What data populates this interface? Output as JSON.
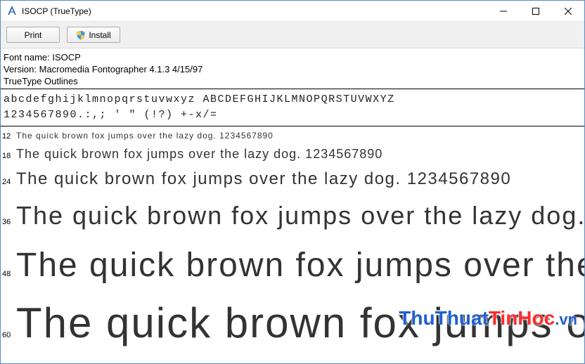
{
  "window": {
    "title": "ISOCP (TrueType)"
  },
  "toolbar": {
    "print_label": "Print",
    "install_label": "Install"
  },
  "info": {
    "fontname_label": "Font name:",
    "fontname_value": "ISOCP",
    "version_label": "Version:",
    "version_value": "Macromedia Fontographer 4.1.3 4/15/97",
    "outlines": "TrueType Outlines"
  },
  "charset": {
    "line1": "abcdefghijklmnopqrstuvwxyz ABCDEFGHIJKLMNOPQRSTUVWXYZ",
    "line2": "1234567890.:,; ' \" (!?) +-x/="
  },
  "sample_text": "The quick brown fox jumps over the lazy dog. 1234567890",
  "samples": [
    {
      "size": "12"
    },
    {
      "size": "18"
    },
    {
      "size": "24"
    },
    {
      "size": "36"
    },
    {
      "size": "48"
    },
    {
      "size": "60"
    }
  ],
  "watermark": {
    "part1": "ThuThuat",
    "part2": "TinHoc",
    "ext": ".vn"
  }
}
